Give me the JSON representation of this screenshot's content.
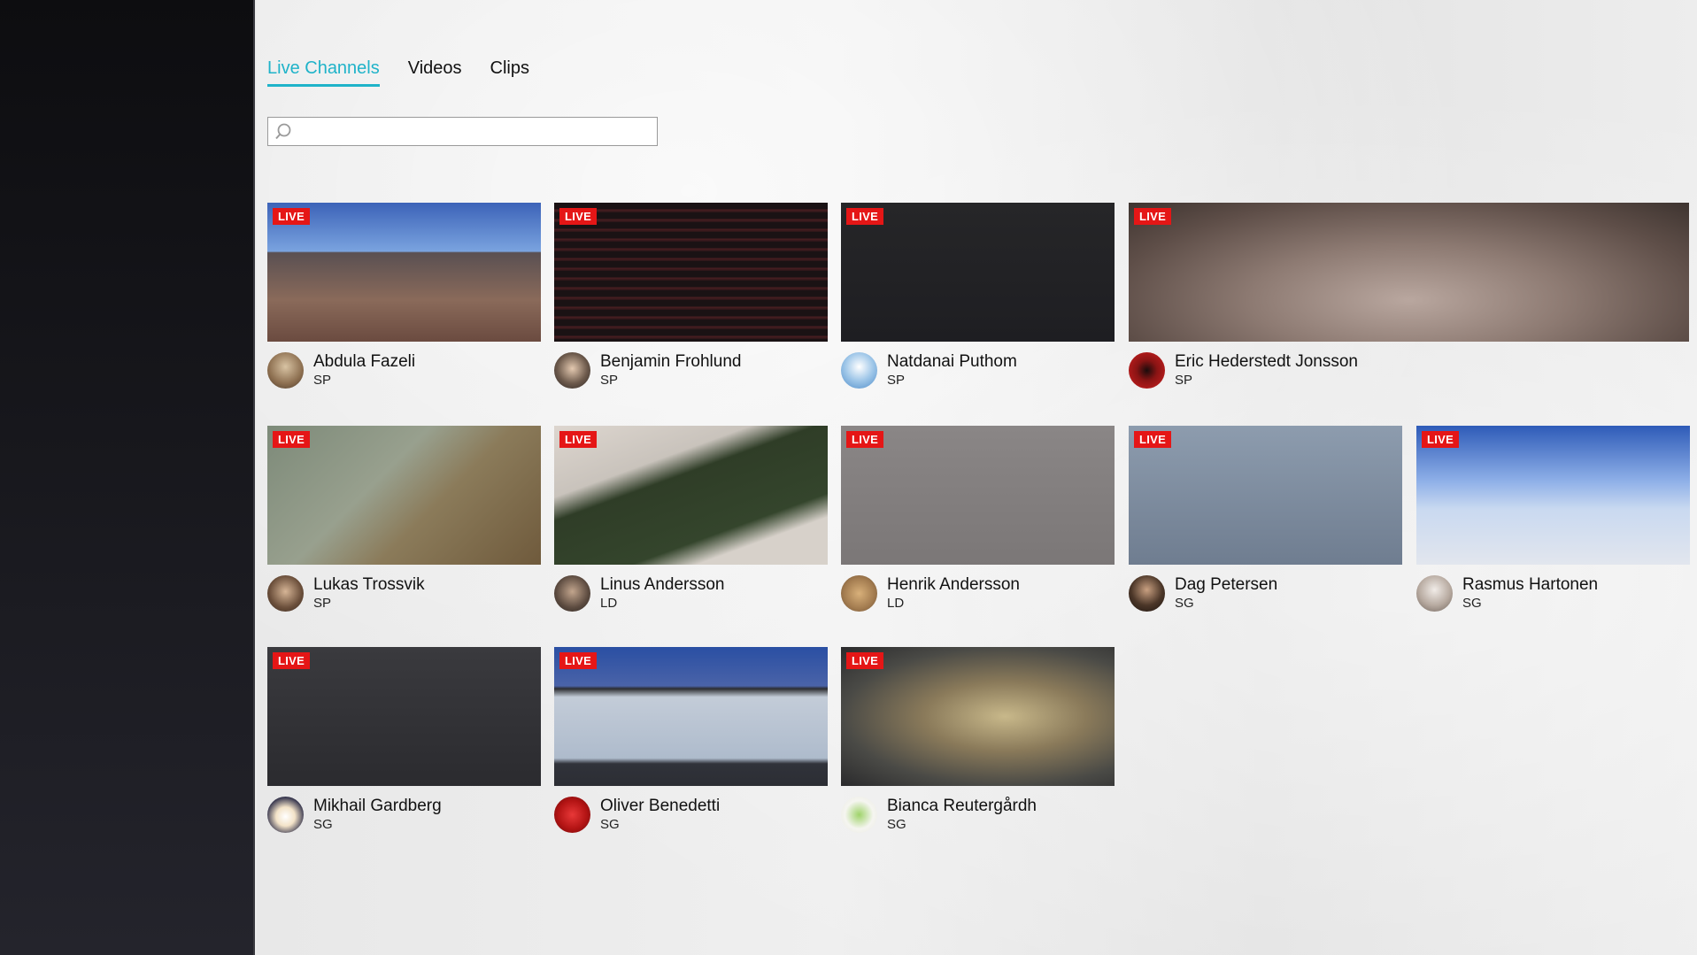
{
  "tabs": [
    {
      "label": "Live Channels",
      "active": true
    },
    {
      "label": "Videos",
      "active": false
    },
    {
      "label": "Clips",
      "active": false
    }
  ],
  "search": {
    "value": "",
    "placeholder": ""
  },
  "live_badge": "LIVE",
  "channels": [
    {
      "name": "Abdula Fazeli",
      "role": "SP"
    },
    {
      "name": "Benjamin Frohlund",
      "role": "SP"
    },
    {
      "name": "Natdanai Puthom",
      "role": "SP"
    },
    {
      "name": "Eric Hederstedt Jonsson",
      "role": "SP"
    },
    {
      "name": "Lukas Trossvik",
      "role": "SP"
    },
    {
      "name": "Linus Andersson",
      "role": "LD"
    },
    {
      "name": "Henrik Andersson",
      "role": "LD"
    },
    {
      "name": "Dag Petersen",
      "role": "SG"
    },
    {
      "name": "Rasmus Hartonen",
      "role": "SG"
    },
    {
      "name": "Mikhail Gardberg",
      "role": "SG"
    },
    {
      "name": "Oliver Benedetti",
      "role": "SG"
    },
    {
      "name": "Bianca Reutergårdh",
      "role": "SG"
    }
  ],
  "colors": {
    "accent": "#1fb3c9",
    "live": "#e51616"
  }
}
